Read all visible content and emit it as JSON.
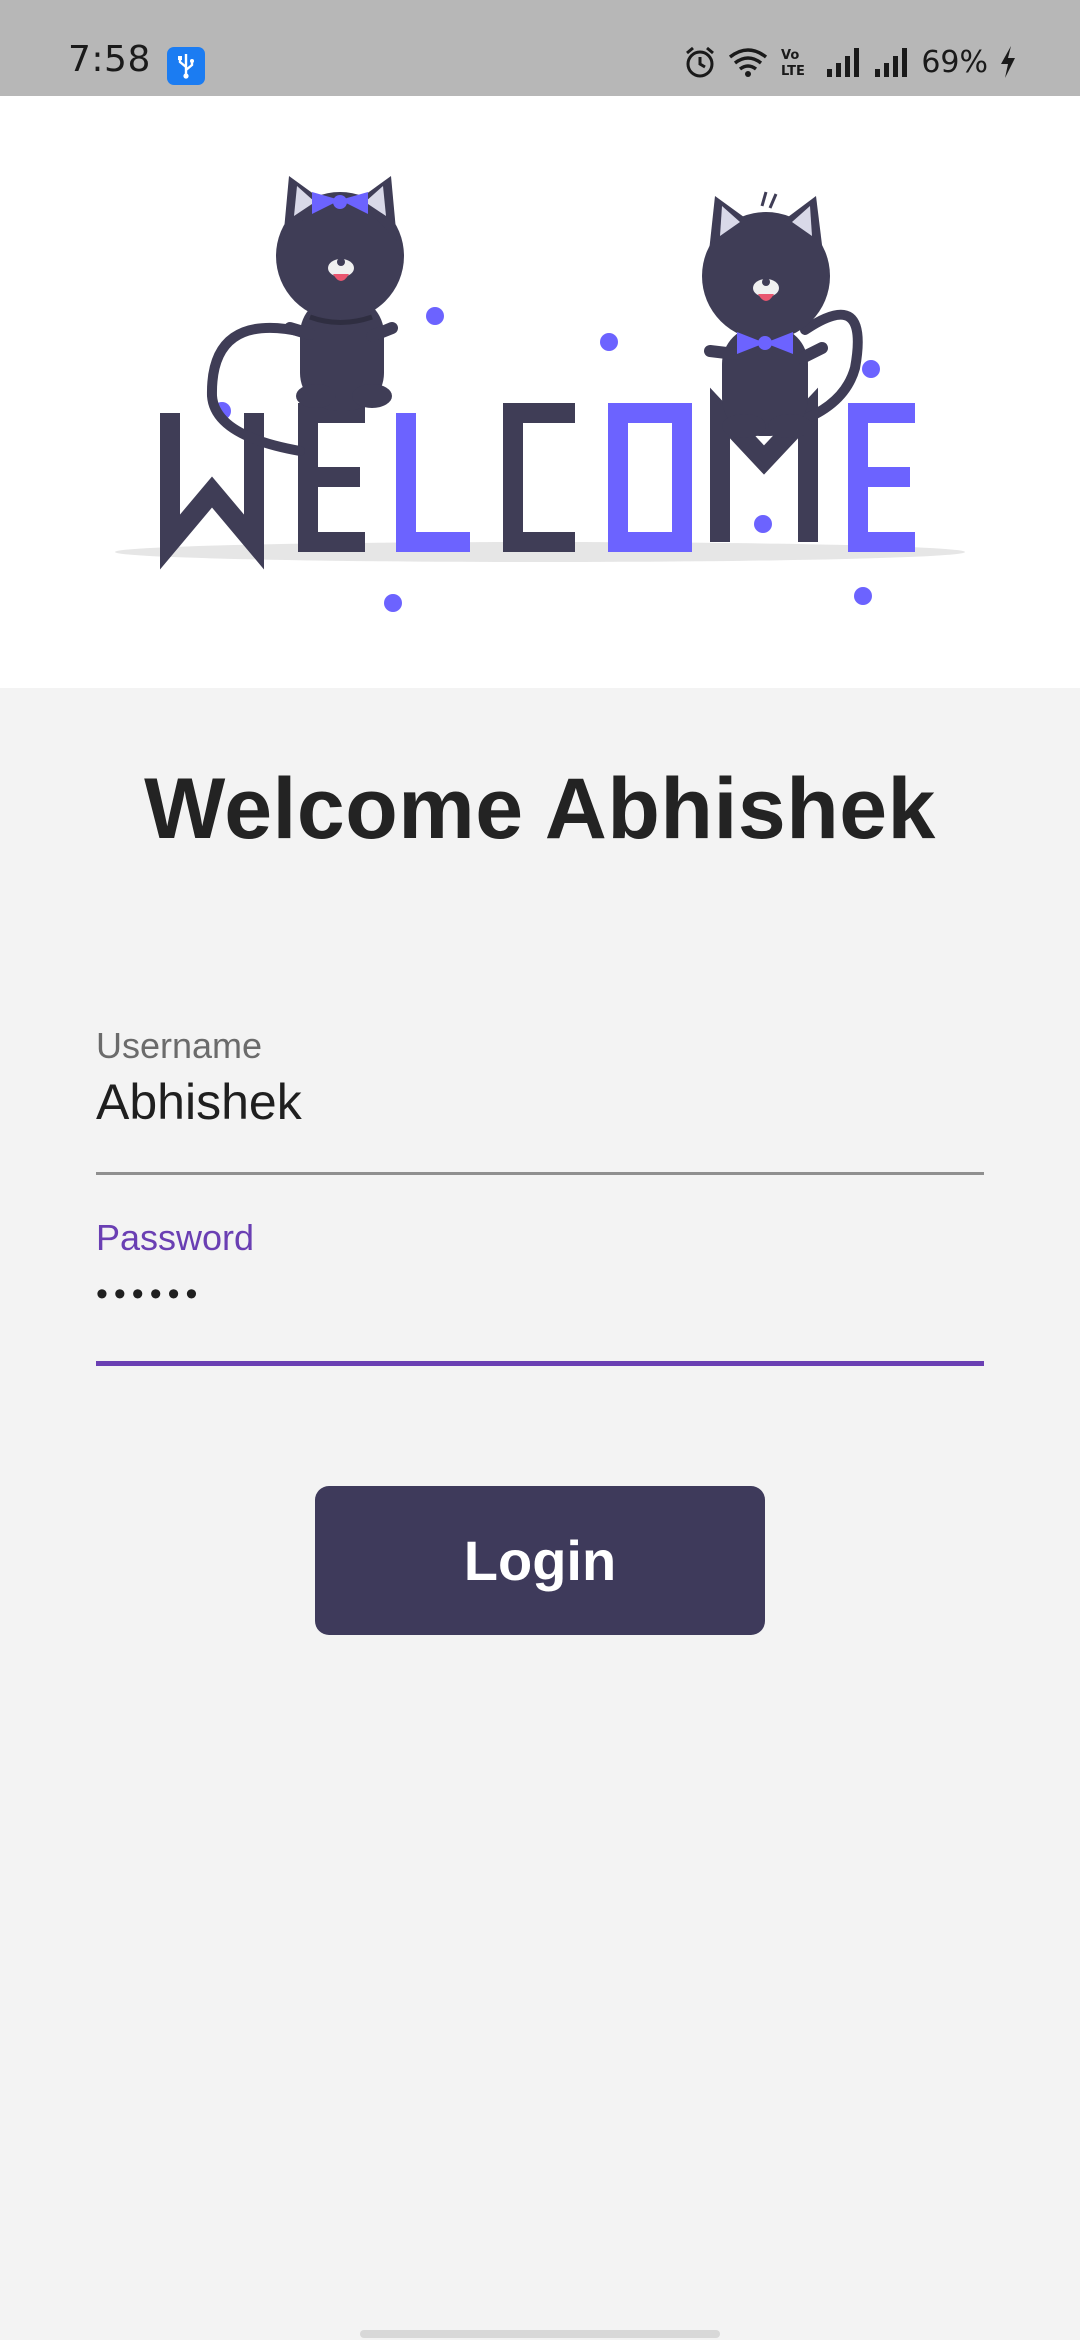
{
  "status_bar": {
    "time": "7:58",
    "battery": "69%",
    "icons": [
      "usb-icon",
      "alarm-icon",
      "wifi-icon",
      "volte-icon",
      "signal-icon",
      "signal-icon",
      "charging-icon"
    ]
  },
  "banner": {
    "welcome_letters": [
      "W",
      "E",
      "L",
      "C",
      "O",
      "M",
      "E"
    ],
    "colors": {
      "dark": "#3f3d56",
      "accent": "#6c63ff"
    }
  },
  "header": {
    "title": "Welcome Abhishek"
  },
  "form": {
    "username": {
      "label": "Username",
      "value": "Abhishek"
    },
    "password": {
      "label": "Password",
      "value": "••••••"
    },
    "login_label": "Login"
  },
  "colors": {
    "primary": "#3e3a5b",
    "focus": "#6a3fb3",
    "background": "#f3f3f3"
  }
}
